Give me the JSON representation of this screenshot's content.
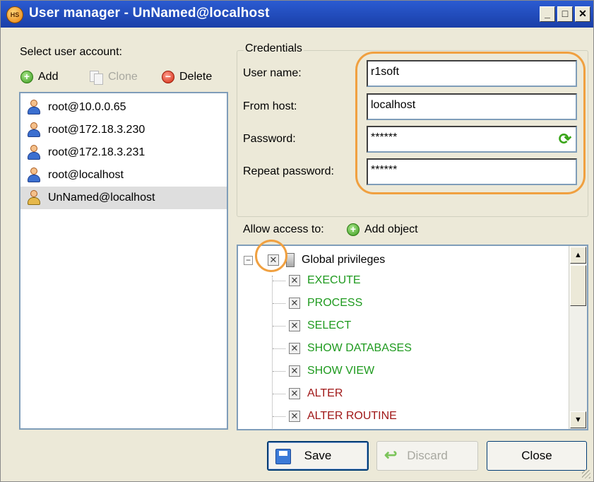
{
  "window": {
    "title": "User manager - UnNamed@localhost",
    "app_icon_text": "HS",
    "minimize": "_",
    "maximize": "□",
    "close": "✕"
  },
  "accounts": {
    "heading": "Select user account:",
    "toolbar": {
      "add": "Add",
      "clone": "Clone",
      "delete": "Delete"
    },
    "items": [
      {
        "label": "root@10.0.0.65",
        "selected": false
      },
      {
        "label": "root@172.18.3.230",
        "selected": false
      },
      {
        "label": "root@172.18.3.231",
        "selected": false
      },
      {
        "label": "root@localhost",
        "selected": false
      },
      {
        "label": "UnNamed@localhost",
        "selected": true
      }
    ]
  },
  "credentials": {
    "title": "Credentials",
    "user_name_label": "User name:",
    "user_name_value": "r1soft",
    "from_host_label": "From host:",
    "from_host_value": "localhost",
    "password_label": "Password:",
    "password_value": "******",
    "repeat_password_label": "Repeat password:",
    "repeat_password_value": "******"
  },
  "access": {
    "label": "Allow access to:",
    "add_object": "Add object",
    "root": {
      "label": "Global privileges",
      "checked": true
    },
    "privileges": [
      {
        "label": "EXECUTE",
        "color": "#1e9a1e"
      },
      {
        "label": "PROCESS",
        "color": "#1e9a1e"
      },
      {
        "label": "SELECT",
        "color": "#1e9a1e"
      },
      {
        "label": "SHOW DATABASES",
        "color": "#1e9a1e"
      },
      {
        "label": "SHOW VIEW",
        "color": "#1e9a1e"
      },
      {
        "label": "ALTER",
        "color": "#a01818"
      },
      {
        "label": "ALTER ROUTINE",
        "color": "#a01818"
      }
    ]
  },
  "buttons": {
    "save": "Save",
    "discard": "Discard",
    "close": "Close"
  },
  "colors": {
    "highlight": "#f0a040",
    "title_bar": "#2b5bd1",
    "granted": "#1e9a1e",
    "revoked": "#a01818"
  }
}
